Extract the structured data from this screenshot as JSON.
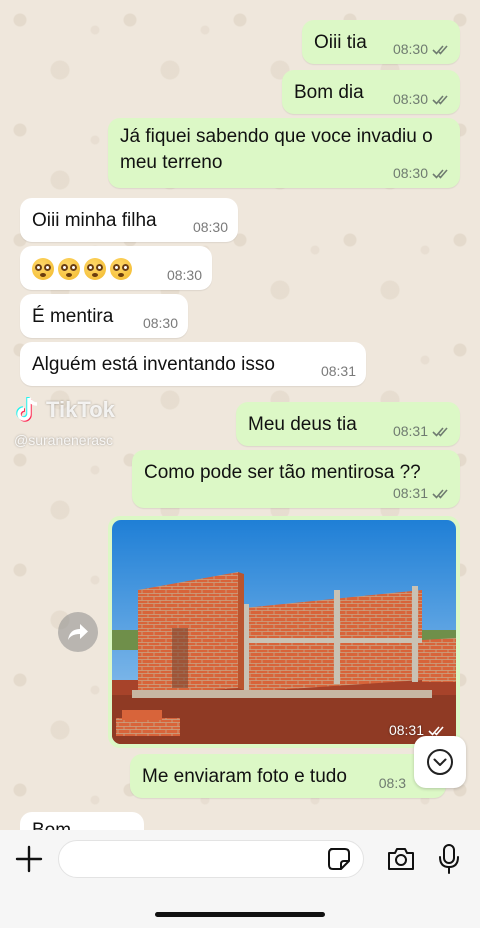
{
  "messages": [
    {
      "dir": "out",
      "text": "Oiii tia",
      "time": "08:30",
      "read": true
    },
    {
      "dir": "out",
      "text": "Bom dia",
      "time": "08:30",
      "read": true
    },
    {
      "dir": "out",
      "text": "Já fiquei sabendo que voce invadiu o meu terreno",
      "time": "08:30",
      "read": true
    },
    {
      "dir": "in",
      "text": "Oiii minha filha",
      "time": "08:30"
    },
    {
      "dir": "in",
      "text": "😳😳😳😳",
      "time": "08:30"
    },
    {
      "dir": "in",
      "text": "É mentira",
      "time": "08:30"
    },
    {
      "dir": "in",
      "text": "Alguém está inventando isso",
      "time": "08:31"
    },
    {
      "dir": "out",
      "text": "Meu deus tia",
      "time": "08:31",
      "read": true
    },
    {
      "dir": "out",
      "text": "Como pode ser tão mentirosa ??",
      "time": "08:31",
      "read": true
    },
    {
      "dir": "out",
      "type": "image",
      "image_alt": "brick house under construction",
      "time": "08:31",
      "read": true
    },
    {
      "dir": "out",
      "text": "Me enviaram foto e tudo",
      "time": "08:3"
    },
    {
      "dir": "in",
      "text": "Bom",
      "time": ""
    }
  ],
  "watermark": {
    "brand": "TikTok",
    "user": "@suranenerasc"
  },
  "input": {
    "placeholder": "",
    "value": ""
  },
  "icons": {
    "plus": "plus-icon",
    "sticker": "sticker-icon",
    "camera": "camera-icon",
    "mic": "mic-icon",
    "forward": "forward-icon",
    "scroll_down": "chevron-down-icon",
    "read": "double-check-icon"
  },
  "colors": {
    "outgoing": "#dcf8c6",
    "incoming": "#ffffff",
    "read_ticks": "#6f7b70"
  }
}
